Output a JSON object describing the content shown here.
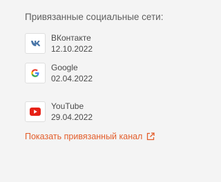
{
  "section": {
    "title": "Привязанные социальные сети:"
  },
  "accounts": [
    {
      "name": "ВКонтакте",
      "date": "12.10.2022",
      "icon": "vk-icon",
      "color": "#4a76a8"
    },
    {
      "name": "Google",
      "date": "02.04.2022",
      "icon": "google-icon",
      "color": "#4285f4"
    },
    {
      "name": "YouTube",
      "date": "29.04.2022",
      "icon": "youtube-icon",
      "color": "#e62117"
    }
  ],
  "link": {
    "label": "Показать привязанный канал",
    "icon": "external-link-icon",
    "color": "#e35d2a"
  }
}
